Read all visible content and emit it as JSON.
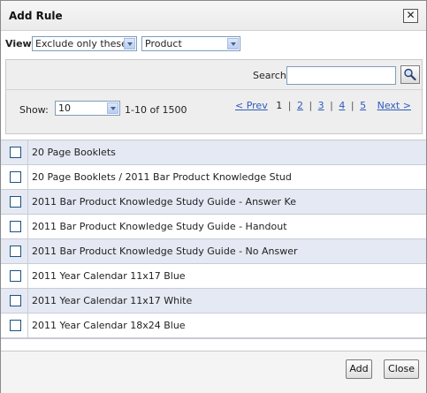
{
  "dialog": {
    "title": "Add Rule",
    "close_glyph": "✕"
  },
  "view": {
    "label": "View",
    "mode_value": "Exclude only these",
    "field_value": "Product"
  },
  "filter": {
    "search_label": "Search",
    "search_value": "",
    "search_icon": "magnifier-icon",
    "show_label": "Show:",
    "page_size_value": "10",
    "range_text": "1-10 of 1500"
  },
  "pager": {
    "prev_label": "< Prev",
    "current": "1",
    "pages": [
      "2",
      "3",
      "4",
      "5"
    ],
    "next_label": "Next >"
  },
  "items": [
    {
      "label": "20 Page Booklets",
      "checked": false
    },
    {
      "label": "20 Page Booklets / 2011 Bar Product Knowledge Stud",
      "checked": false
    },
    {
      "label": "2011 Bar Product Knowledge Study Guide - Answer Ke",
      "checked": false
    },
    {
      "label": "2011 Bar Product Knowledge Study Guide - Handout",
      "checked": false
    },
    {
      "label": "2011 Bar Product Knowledge Study Guide - No Answer",
      "checked": false
    },
    {
      "label": "2011 Year Calendar 11x17 Blue",
      "checked": false
    },
    {
      "label": "2011 Year Calendar 11x17 White",
      "checked": false
    },
    {
      "label": "2011 Year Calendar 18x24 Blue",
      "checked": false
    }
  ],
  "footer": {
    "add_label": "Add",
    "close_label": "Close"
  },
  "colors": {
    "row_alt": "#e4e9f3",
    "link": "#2e5bbb",
    "checkbox_border": "#1c5180"
  }
}
